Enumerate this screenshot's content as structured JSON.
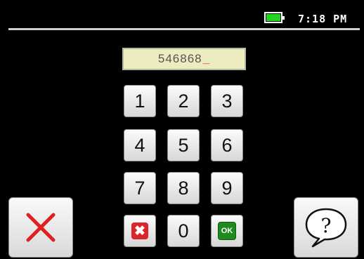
{
  "status_bar": {
    "time": "7:18 PM",
    "battery_color": "#1ed81e",
    "battery_icon": "battery-full-icon"
  },
  "pin_entry": {
    "value": "546868",
    "cursor": "_"
  },
  "keypad": {
    "row1": [
      "1",
      "2",
      "3"
    ],
    "row2": [
      "4",
      "5",
      "6"
    ],
    "row3": [
      "7",
      "8",
      "9"
    ],
    "zero": "0",
    "ok_label": "OK",
    "delete_icon": "backspace-x-icon"
  },
  "cancel_button": {
    "icon": "close-x-icon",
    "color": "#e02020"
  },
  "help_button": {
    "icon": "question-speech-bubble-icon",
    "glyph": "?"
  }
}
